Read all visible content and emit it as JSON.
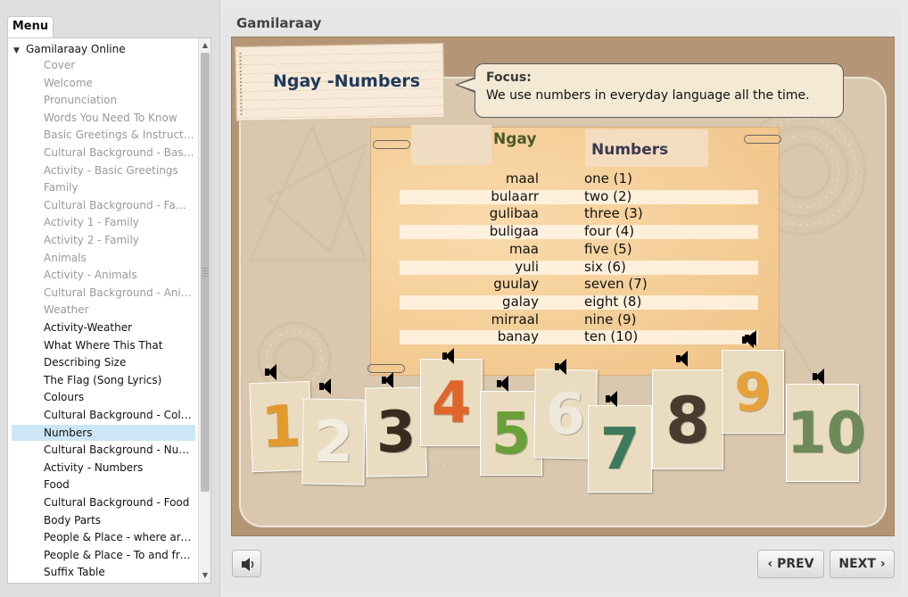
{
  "sidebar": {
    "tab_label": "Menu",
    "root": "Gamilaraay Online",
    "items": [
      {
        "label": "Cover",
        "state": "disabled"
      },
      {
        "label": "Welcome",
        "state": "disabled"
      },
      {
        "label": "Pronunciation",
        "state": "disabled"
      },
      {
        "label": "Words You Need To Know",
        "state": "disabled"
      },
      {
        "label": "Basic Greetings & Instruction...",
        "state": "disabled"
      },
      {
        "label": "Cultural Background - Basic ...",
        "state": "disabled"
      },
      {
        "label": "Activity - Basic Greetings",
        "state": "disabled"
      },
      {
        "label": "Family",
        "state": "disabled"
      },
      {
        "label": "Cultural Background - Family",
        "state": "disabled"
      },
      {
        "label": "Activity 1 - Family",
        "state": "disabled"
      },
      {
        "label": "Activity 2 - Family",
        "state": "disabled"
      },
      {
        "label": "Animals",
        "state": "disabled"
      },
      {
        "label": "Activity - Animals",
        "state": "disabled"
      },
      {
        "label": "Cultural Background - Animals",
        "state": "disabled"
      },
      {
        "label": "Weather",
        "state": "disabled"
      },
      {
        "label": "Activity-Weather",
        "state": "enabled"
      },
      {
        "label": "What Where This That",
        "state": "enabled"
      },
      {
        "label": " Describing Size",
        "state": "enabled"
      },
      {
        "label": "The Flag (Song Lyrics)",
        "state": "enabled"
      },
      {
        "label": "Colours",
        "state": "enabled"
      },
      {
        "label": "Cultural Background - Colours",
        "state": "enabled"
      },
      {
        "label": "Numbers",
        "state": "selected"
      },
      {
        "label": "Cultural Background - Numb...",
        "state": "enabled"
      },
      {
        "label": "Activity - Numbers",
        "state": "enabled"
      },
      {
        "label": "Food",
        "state": "enabled"
      },
      {
        "label": "Cultural Background - Food",
        "state": "enabled"
      },
      {
        "label": "Body Parts",
        "state": "enabled"
      },
      {
        "label": "People & Place - where are y...",
        "state": "enabled"
      },
      {
        "label": "People & Place -  To and fro...",
        "state": "enabled"
      },
      {
        "label": "Suffix Table",
        "state": "enabled"
      }
    ]
  },
  "main": {
    "title": "Gamilaraay",
    "slide_title": "Ngay -Numbers",
    "focus_label": "Focus:",
    "focus_text": "We use numbers in everyday language all the time.",
    "column_headers": {
      "left": "Ngay",
      "right": "Numbers"
    },
    "numbers": [
      {
        "ngay": "maal",
        "english": "one (1)"
      },
      {
        "ngay": "bulaarr",
        "english": "two (2)"
      },
      {
        "ngay": "gulibaa",
        "english": "three (3)"
      },
      {
        "ngay": "buligaa",
        "english": "four (4)"
      },
      {
        "ngay": "maa",
        "english": "five (5)"
      },
      {
        "ngay": "yuli",
        "english": "six (6)"
      },
      {
        "ngay": "guulay",
        "english": "seven (7)"
      },
      {
        "ngay": "galay",
        "english": "eight (8)"
      },
      {
        "ngay": "mirraal",
        "english": "nine (9)"
      },
      {
        "ngay": "banay",
        "english": "ten (10)"
      }
    ],
    "cards": [
      {
        "digit": "1",
        "color": "#e39a2c"
      },
      {
        "digit": "2",
        "color": "#f3ece0"
      },
      {
        "digit": "3",
        "color": "#3a2a20"
      },
      {
        "digit": "4",
        "color": "#e0652a"
      },
      {
        "digit": "5",
        "color": "#6aa03a"
      },
      {
        "digit": "6",
        "color": "#efe8dd"
      },
      {
        "digit": "7",
        "color": "#3d7a5c"
      },
      {
        "digit": "8",
        "color": "#4a3a30"
      },
      {
        "digit": "9",
        "color": "#e6a23a"
      },
      {
        "digit": "10",
        "color": "#6e8a5a"
      }
    ]
  },
  "nav": {
    "prev_label": "PREV",
    "next_label": "NEXT",
    "prev_icon": "chevron-left-icon",
    "next_icon": "chevron-right-icon",
    "audio_icon": "speaker-icon"
  }
}
